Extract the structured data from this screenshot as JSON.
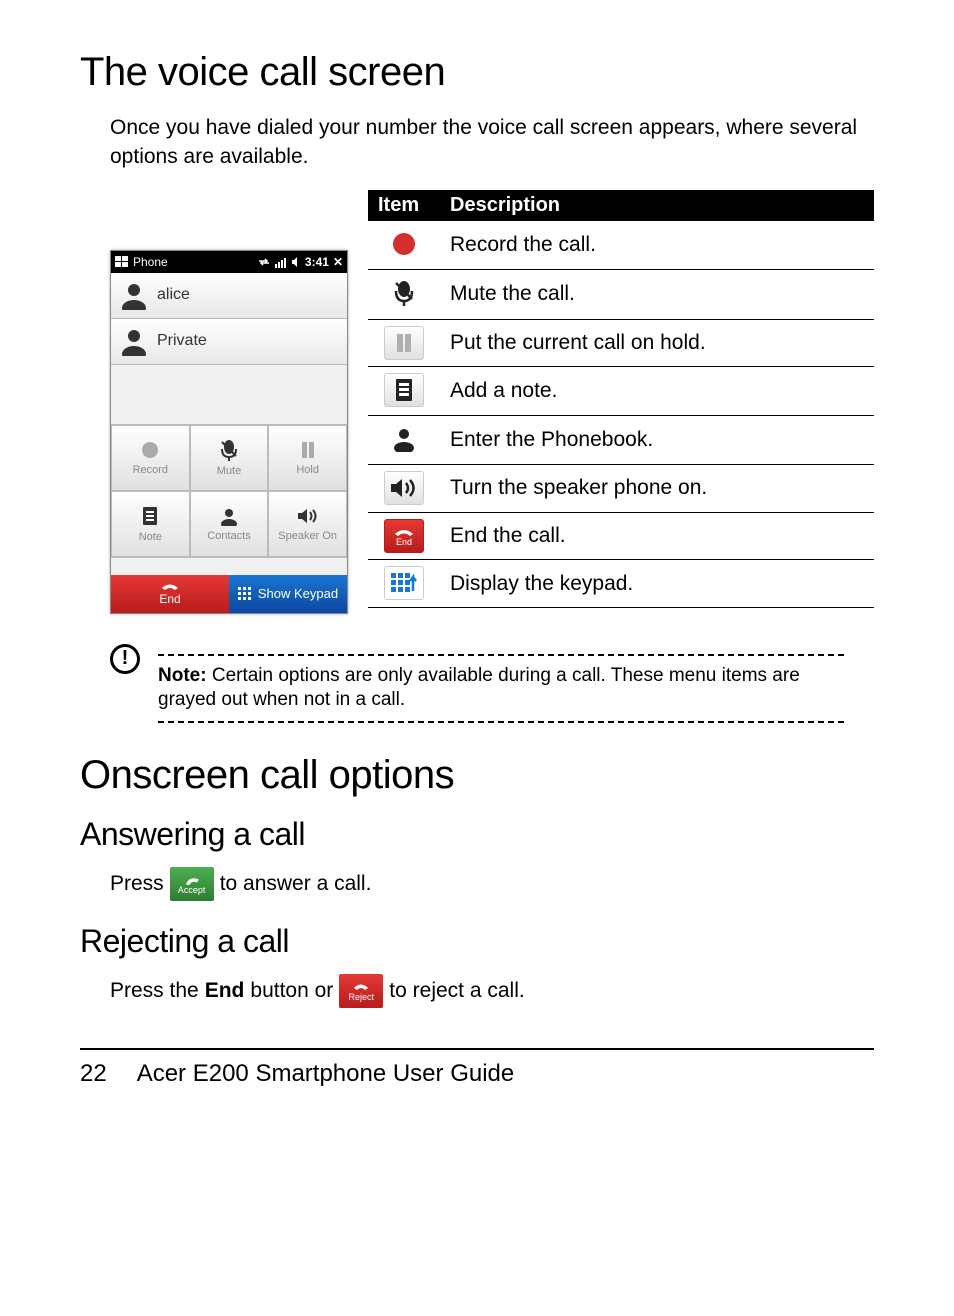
{
  "h1": "The voice call screen",
  "intro": "Once you have dialed your number the voice call screen appears, where several options are available.",
  "phone": {
    "status_label": "Phone",
    "status_time": "3:41",
    "contacts": [
      "alice",
      "Private"
    ],
    "buttons": [
      "Record",
      "Mute",
      "Hold",
      "Note",
      "Contacts",
      "Speaker On"
    ],
    "end": "End",
    "keypad": "Show Keypad"
  },
  "table": {
    "headers": [
      "Item",
      "Description"
    ],
    "rows": [
      "Record the call.",
      "Mute the call.",
      "Put the current call on hold.",
      "Add a note.",
      "Enter the Phonebook.",
      "Turn the speaker phone on.",
      "End the call.",
      "Display the keypad."
    ],
    "end_icon_label": "End"
  },
  "note_label": "Note:",
  "note_text": " Certain options are only available during a call. These menu items are grayed out when not in a call.",
  "h1b": "Onscreen call options",
  "h2a": "Answering a call",
  "answer_pre": "Press",
  "answer_post": "to answer a call.",
  "accept_label": "Accept",
  "h2b": "Rejecting a call",
  "reject_pre": "Press the",
  "reject_mid": "button or",
  "reject_post": "to reject a call.",
  "reject_label": "Reject",
  "end_word": "End",
  "footer_page": "22",
  "footer_title": "Acer E200 Smartphone User Guide"
}
